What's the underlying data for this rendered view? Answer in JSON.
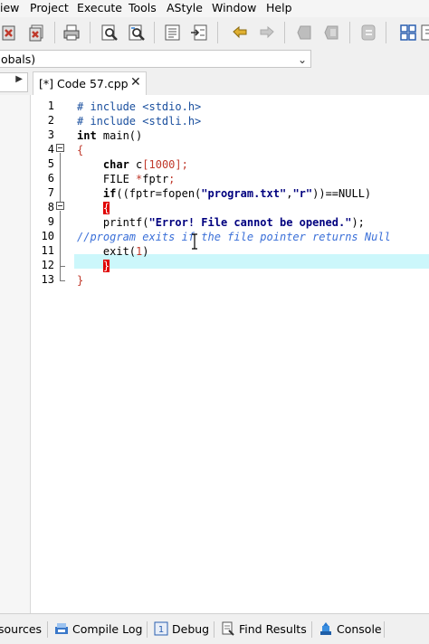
{
  "menubar": {
    "items": [
      {
        "label": "iew"
      },
      {
        "label": "Project"
      },
      {
        "label": "Execute"
      },
      {
        "label": "Tools"
      },
      {
        "label": "AStyle"
      },
      {
        "label": "Window"
      },
      {
        "label": "Help"
      }
    ]
  },
  "scope_bar": {
    "value": "obals)"
  },
  "tabs": {
    "active_label": "[*] Code 57.cpp",
    "close_glyph": "✕"
  },
  "editor": {
    "line_numbers": [
      "1",
      "2",
      "3",
      "4",
      "5",
      "6",
      "7",
      "8",
      "9",
      "10",
      "11",
      "12",
      "13"
    ],
    "current_line": 12
  },
  "bottom_tabs": [
    {
      "label": "sources",
      "icon": "resources-icon"
    },
    {
      "label": "Compile Log",
      "icon": "compile-log-icon"
    },
    {
      "label": "Debug",
      "icon": "debug-icon"
    },
    {
      "label": "Find Results",
      "icon": "find-results-icon"
    },
    {
      "label": "Console",
      "icon": "console-icon"
    }
  ],
  "colors": {
    "current_line": "#ccf7fb",
    "keyword": "#000000",
    "preprocessor": "#1a4f9e",
    "string": "#00007f",
    "number": "#c0392b",
    "comment": "#3a6fd8",
    "brace_highlight": "#e00000"
  }
}
